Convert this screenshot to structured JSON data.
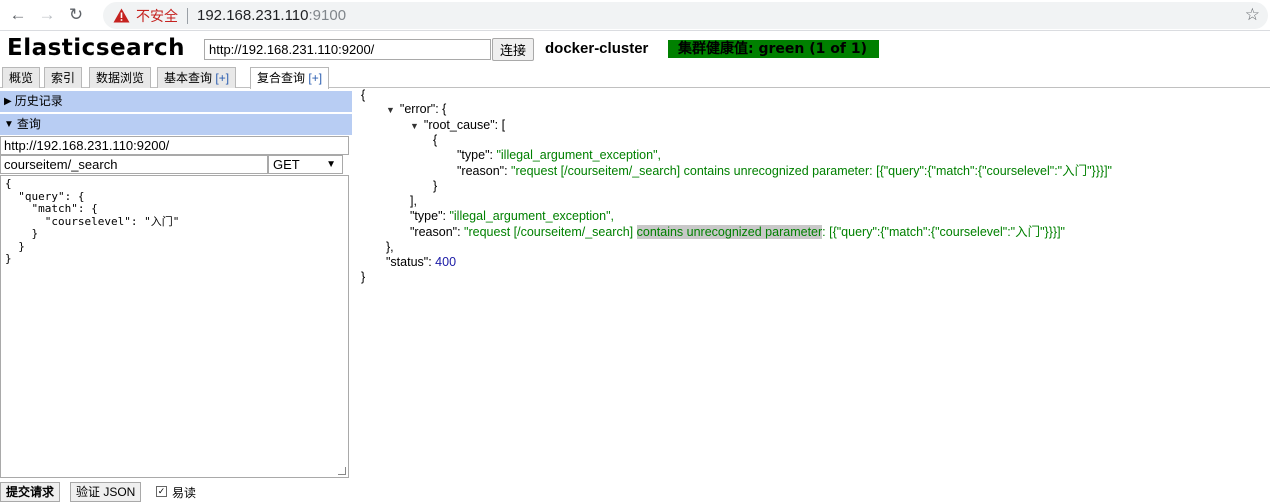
{
  "browser": {
    "insecure_label": "不安全",
    "url_host": "192.168.231.110",
    "url_port": ":9100"
  },
  "header": {
    "title": "Elasticsearch",
    "connection_url": "http://192.168.231.110:9200/",
    "connect_label": "连接",
    "cluster_name": "docker-cluster",
    "health_text": "集群健康值: green (1 of 1)",
    "health_color": "#008000"
  },
  "tabs": [
    {
      "label": "概览",
      "plus": ""
    },
    {
      "label": "索引",
      "plus": ""
    },
    {
      "label": "数据浏览",
      "plus": ""
    },
    {
      "label": "基本查询",
      "plus": "[+]"
    },
    {
      "label": "复合查询",
      "plus": "[+]"
    }
  ],
  "left": {
    "history_label": "历史记录",
    "query_label": "查询",
    "host_value": "http://192.168.231.110:9200/",
    "path_value": "courseitem/_search",
    "method_value": "GET",
    "editor_lines": [
      "{",
      "  \"query\": {",
      "    \"match\": {",
      "      \"courselevel\": \"入门\"",
      "    }",
      "  }",
      "}"
    ],
    "submit_label": "提交请求",
    "validate_label": "验证 JSON",
    "checkbox_label": "易读"
  },
  "response": {
    "lines": [
      "{",
      "\"error\": {",
      "\"root_cause\": [",
      "{",
      "\"type\": ",
      "\"illegal_argument_exception\",",
      "\"reason\": ",
      "\"request [/courseitem/_search] contains unrecognized parameter: [{\"query\":{\"match\":{\"courselevel\":\"入门\"}}}]\"",
      "}",
      "],",
      "\"type\": ",
      "\"illegal_argument_exception\",",
      "\"reason\": ",
      "\"request [/courseitem/_search] ",
      "contains unrecognized parameter",
      ": [{\"query\":{\"match\":{\"courselevel\":\"入门\"}}}]\"",
      "},",
      "\"status\": ",
      "400",
      "}"
    ]
  }
}
